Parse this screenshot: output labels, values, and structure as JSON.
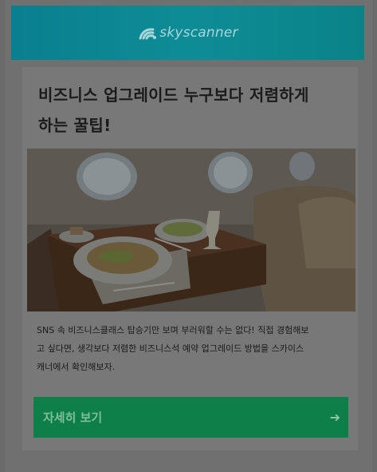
{
  "header": {
    "brand_name": "skyscanner",
    "logo_icon": "skyscanner-sunrise-icon"
  },
  "article": {
    "title_line1": "비즈니스 업그레이드 누구보다 저렴하게",
    "title_line2": "하는 꿀팁!",
    "image_icon": "business-class-cabin-photo",
    "description_line1": "SNS 속 비즈니스클래스 탑승기만 보며 부러워할 수는 없다! 직접 경험해보",
    "description_line2": "고 싶다면, 생각보다 저렴한 비즈니스석 예약 업그레이드 방법을 스카이스",
    "description_line3": "캐너에서 확인해보자."
  },
  "cta": {
    "label": "자세히 보기",
    "arrow_icon": "arrow-right-icon",
    "arrow_glyph": "➔"
  },
  "colors": {
    "header": "#0e8c96",
    "cta": "#0f7f49",
    "overlay_background": "#707070"
  }
}
